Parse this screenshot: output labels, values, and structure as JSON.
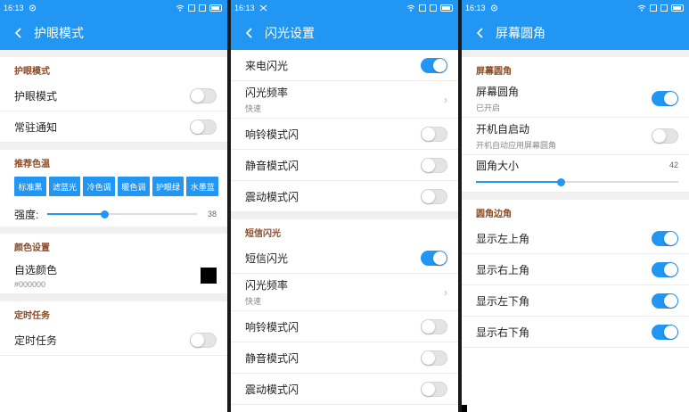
{
  "status": {
    "time": "16:13"
  },
  "screen1": {
    "title": "护眼模式",
    "section_eye": "护眼模式",
    "eye_mode": {
      "label": "护眼模式",
      "on": false
    },
    "notify": {
      "label": "常驻通知",
      "on": false
    },
    "section_temp": "推荐色温",
    "presets": [
      "标准黑",
      "滤蓝光",
      "冷色调",
      "暖色调",
      "护眼绿",
      "水墨蓝"
    ],
    "strength": {
      "label": "强度:",
      "value": "38",
      "percent": 38
    },
    "section_color": "颜色设置",
    "custom_color": {
      "label": "自选颜色",
      "value": "#000000",
      "swatch": "#000000"
    },
    "section_timer": "定时任务",
    "timer": {
      "label": "定时任务",
      "on": false
    }
  },
  "screen2": {
    "title": "闪光设置",
    "call_flash": {
      "label": "来电闪光",
      "on": true
    },
    "call_freq": {
      "label": "闪光频率",
      "value": "快速"
    },
    "call_ring": {
      "label": "响铃模式闪",
      "on": false
    },
    "call_silent": {
      "label": "静音模式闪",
      "on": false
    },
    "call_vibrate": {
      "label": "震动模式闪",
      "on": false
    },
    "section_sms": "短信闪光",
    "sms_flash": {
      "label": "短信闪光",
      "on": true
    },
    "sms_freq": {
      "label": "闪光频率",
      "value": "快速"
    },
    "sms_ring": {
      "label": "响铃模式闪",
      "on": false
    },
    "sms_silent": {
      "label": "静音模式闪",
      "on": false
    },
    "sms_vibrate": {
      "label": "震动模式闪",
      "on": false
    }
  },
  "screen3": {
    "title": "屏幕圆角",
    "section_round": "屏幕圆角",
    "round": {
      "label": "屏幕圆角",
      "sub": "已开启",
      "on": true
    },
    "autostart": {
      "label": "开机自启动",
      "sub": "开机自动应用屏幕圆角",
      "on": false
    },
    "radius": {
      "label": "圆角大小",
      "value": "42",
      "percent": 42
    },
    "section_corners": "圆角边角",
    "top_left": {
      "label": "显示左上角",
      "on": true
    },
    "top_right": {
      "label": "显示右上角",
      "on": true
    },
    "bottom_left": {
      "label": "显示左下角",
      "on": true
    },
    "bottom_right": {
      "label": "显示右下角",
      "on": true
    }
  },
  "colors": {
    "accent": "#2196f3",
    "section_header": "#8a4a25"
  }
}
